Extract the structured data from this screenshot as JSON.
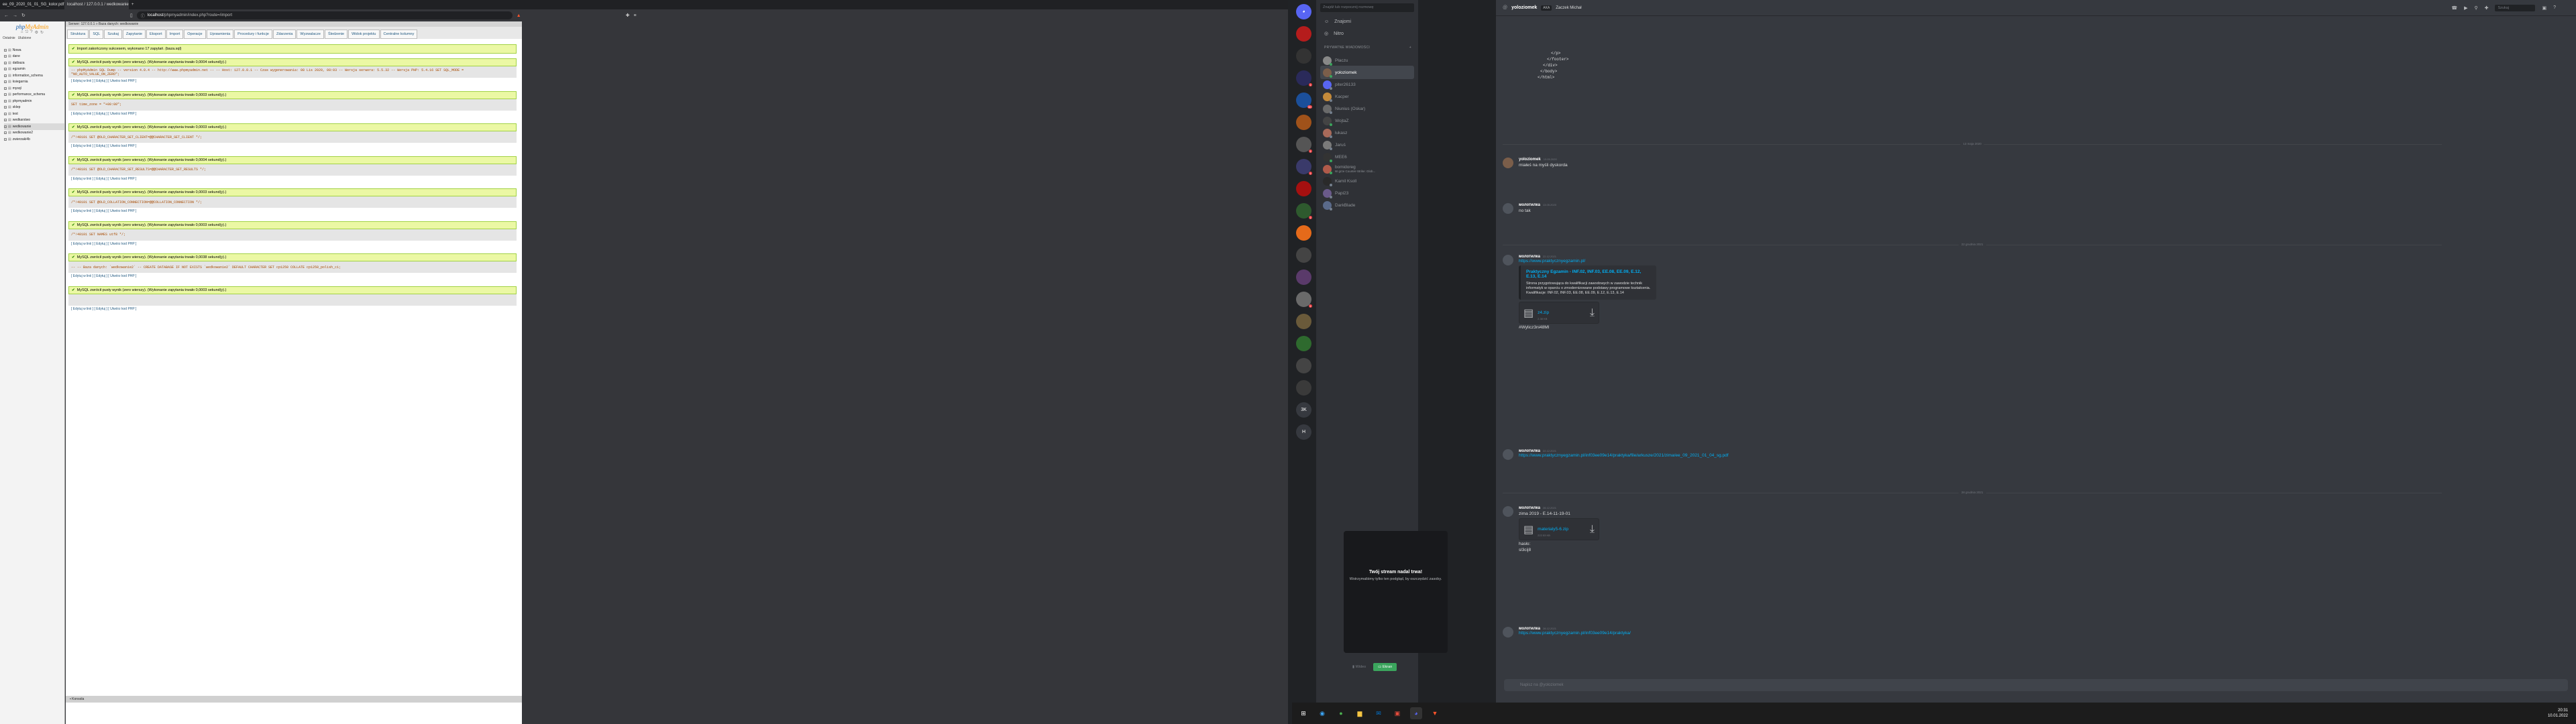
{
  "browser": {
    "tabs": [
      {
        "label": "ee_09_2020_01_01_SG_kolor.pdf"
      },
      {
        "label": "localhost / 127.0.0.1 / wedkowanie"
      }
    ],
    "new_tab": "+",
    "url_host": "localhost",
    "url_path": "/phpmyadmin/index.php?route=/import"
  },
  "pma": {
    "logo_a": "php",
    "logo_b": "MyAdmin",
    "nav": [
      "Ostatnie",
      "Ulubione"
    ],
    "databases": [
      "Nowa",
      "dane",
      "datbaza",
      "egzamin",
      "information_schema",
      "ksiegarnia",
      "mysql",
      "performance_schema",
      "phpmyadmin",
      "sklep",
      "test",
      "wedkarstwo",
      "wedkowanie",
      "wedkowanie2",
      "zwierzaki4b"
    ],
    "breadcrumb": "Serwer: 127.0.0.1 » Baza danych: wedkowanie",
    "tabs": [
      "Struktura",
      "SQL",
      "Szukaj",
      "Zapytanie",
      "Eksport",
      "Import",
      "Operacje",
      "Uprawnienia",
      "Procedury i funkcje",
      "Zdarzenia",
      "Wyzwalacze",
      "Śledzenie",
      "Widok projektu",
      "Centralne kolumny"
    ],
    "import_msg": "Import zakończony sukcesem, wykonano 17 zapytań. (baza.sql)",
    "blocks": [
      {
        "ok": "MySQL zwrócił pusty wynik (zero wierszy). (Wykonanie zapytania trwało 0,0004 sekund(y).)",
        "sql": "-- phpMyAdmin SQL Dump -- version 4.0.4 -- http://www.phpmyadmin.net -- -- Host: 127.0.0.1 -- Czas wygenerowania: 08 Lis 2020, 08:03 -- Wersja serwera: 5.5.32 -- Wersja PHP: 5.4.16 SET SQL_MODE = \"NO_AUTO_VALUE_ON_ZERO\";"
      },
      {
        "ok": "MySQL zwrócił pusty wynik (zero wierszy). (Wykonanie zapytania trwało 0,0003 sekund(y).)",
        "sql": "SET time_zone = \"+00:00\";"
      },
      {
        "ok": "MySQL zwrócił pusty wynik (zero wierszy). (Wykonanie zapytania trwało 0,0003 sekund(y).)",
        "sql": "/*!40101 SET @OLD_CHARACTER_SET_CLIENT=@@CHARACTER_SET_CLIENT */;"
      },
      {
        "ok": "MySQL zwrócił pusty wynik (zero wierszy). (Wykonanie zapytania trwało 0,0004 sekund(y).)",
        "sql": "/*!40101 SET @OLD_CHARACTER_SET_RESULTS=@@CHARACTER_SET_RESULTS */;"
      },
      {
        "ok": "MySQL zwrócił pusty wynik (zero wierszy). (Wykonanie zapytania trwało 0,0003 sekund(y).)",
        "sql": "/*!40101 SET @OLD_COLLATION_CONNECTION=@@COLLATION_CONNECTION */;"
      },
      {
        "ok": "MySQL zwrócił pusty wynik (zero wierszy). (Wykonanie zapytania trwało 0,0003 sekund(y).)",
        "sql": "/*!40101 SET NAMES utf8 */;"
      },
      {
        "ok": "MySQL zwrócił pusty wynik (zero wierszy). (Wykonanie zapytania trwało 0,0038 sekund(y).)",
        "sql": "-- -- Baza danych: `wedkowanie2` -- CREATE DATABASE IF NOT EXISTS `wedkowanie2` DEFAULT CHARACTER SET cp1250 COLLATE cp1250_polish_ci;"
      },
      {
        "ok": "MySQL zwrócił pusty wynik (zero wierszy). (Wykonanie zapytania trwało 0,0003 sekund(y).)",
        "sql": ""
      }
    ],
    "links": "[ Edytuj w linii ] [ Edytuj ] [ Utwórz kod PHP ]",
    "console": "Konsola"
  },
  "discord": {
    "guild_badges": [
      "1",
      "30",
      "1",
      "1",
      "1",
      "1"
    ],
    "guild_labels": [
      "3K",
      "H"
    ],
    "search_placeholder": "Znajdź lub rozpocznij rozmowę",
    "nav": [
      "Znajomi",
      "Nitro"
    ],
    "dm_header": "PRYWATNE WIADOMOŚCI",
    "dm_add": "+",
    "dms": [
      {
        "name": "Płaczu",
        "sub": ""
      },
      {
        "name": "yoloziomek",
        "sub": ""
      },
      {
        "name": "piter26133",
        "sub": ""
      },
      {
        "name": "Kacper",
        "sub": ""
      },
      {
        "name": "Niunius (Oskar)",
        "sub": ""
      },
      {
        "name": "WojtaZ",
        "sub": ""
      },
      {
        "name": "łukasz",
        "sub": ""
      },
      {
        "name": "Jaruś",
        "sub": ""
      },
      {
        "name": "MEE6",
        "sub": ""
      },
      {
        "name": "bomidoreg",
        "sub": "W grze Counter-Strike: Glob..."
      },
      {
        "name": "Kamil Ksoll",
        "sub": ""
      },
      {
        "name": "Papi23",
        "sub": ""
      },
      {
        "name": "DarkBlade",
        "sub": ""
      }
    ],
    "stream_title": "Twój stream nadal trwa!",
    "stream_desc": "Wstrzymaliśmy tylko ten podgląd, by oszczędzić zasoby.",
    "stream_btn_video": "Wideo",
    "stream_btn_screen": "Ekran",
    "chat": {
      "user": "yoloziomek",
      "aka": "AKA",
      "aka_name": "Zaczek Michał",
      "search": "Szukaj",
      "code_lines": [
        "</p>",
        "</footer>",
        "</div>",
        "</body>",
        "</html>"
      ],
      "div1": "13 maja 2020",
      "m1_user": "yoloziomek",
      "m1_ts": "13.05.2020",
      "m1_text": "miałeś na myśli dyskorda",
      "m2_user": "молотилка",
      "m2_ts": "13.05.2020",
      "m2_text": "no tak",
      "div2": "22 grudnia 2021",
      "m3_user": "молотилка",
      "m3_ts": "22.12.2021",
      "m3_link": "https://www.praktycznyegzamin.pl/",
      "embed_title": "Praktyczny Egzamin - INF.02, INF.03, EE.08, EE.09, E.12, E.13, E.14",
      "embed_desc": "Strona przygotowująca do kwalifikacji zawodowych w zawodzie technik informatyk w oparciu o zmodernizowane podstawy programowe kształcenia. Kwalifikacje: INF.02, INF.03, EE.08, EE.09, E.12, E.13, E.14",
      "file1": "z4.zip",
      "file1_size": "2.38 KB",
      "m3_text2": "#Wylicz3ni48MI",
      "m4_user": "молотилка",
      "m4_ts": "22.12.2021",
      "m4_link": "https://www.praktycznyegzamin.pl/inf03ee09e14/praktyka/file/arkusze/2021/zima/ee_09_2021_01_04_sg.pdf",
      "div3": "28 grudnia 2021",
      "m5_user": "молотилка",
      "m5_ts": "28.12.2021",
      "m5_text": "zima 2019 - E.14-11-19-01",
      "file2": "materialy5-6.zip",
      "file2_size": "222.53 KB",
      "m5_text2": "hasło:",
      "m5_text3": "sl3cij8",
      "m6_user": "молотилка",
      "m6_ts": "28.12.2021",
      "m6_link": "https://www.praktycznyegzamin.pl/inf03ee09e14/praktyka/",
      "input_placeholder": "Napisz na @yoloziomek"
    }
  },
  "taskbar": {
    "time": "20:31",
    "date": "10.01.2022"
  }
}
